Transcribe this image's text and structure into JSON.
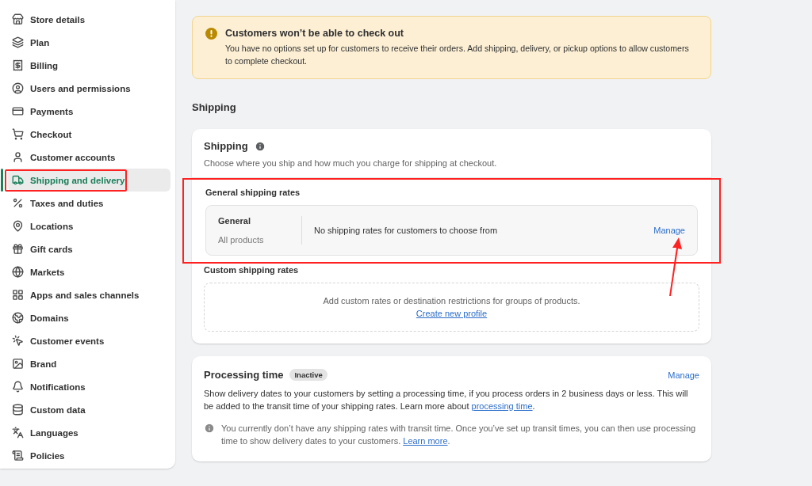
{
  "sidebar": {
    "items": [
      {
        "label": "Store details",
        "selected": false,
        "highlighted": false
      },
      {
        "label": "Plan",
        "selected": false,
        "highlighted": false
      },
      {
        "label": "Billing",
        "selected": false,
        "highlighted": false
      },
      {
        "label": "Users and permissions",
        "selected": false,
        "highlighted": false
      },
      {
        "label": "Payments",
        "selected": false,
        "highlighted": false
      },
      {
        "label": "Checkout",
        "selected": false,
        "highlighted": false
      },
      {
        "label": "Customer accounts",
        "selected": false,
        "highlighted": false
      },
      {
        "label": "Shipping and delivery",
        "selected": true,
        "highlighted": true
      },
      {
        "label": "Taxes and duties",
        "selected": false,
        "highlighted": false
      },
      {
        "label": "Locations",
        "selected": false,
        "highlighted": false
      },
      {
        "label": "Gift cards",
        "selected": false,
        "highlighted": false
      },
      {
        "label": "Markets",
        "selected": false,
        "highlighted": false
      },
      {
        "label": "Apps and sales channels",
        "selected": false,
        "highlighted": false
      },
      {
        "label": "Domains",
        "selected": false,
        "highlighted": false
      },
      {
        "label": "Customer events",
        "selected": false,
        "highlighted": false
      },
      {
        "label": "Brand",
        "selected": false,
        "highlighted": false
      },
      {
        "label": "Notifications",
        "selected": false,
        "highlighted": false
      },
      {
        "label": "Custom data",
        "selected": false,
        "highlighted": false
      },
      {
        "label": "Languages",
        "selected": false,
        "highlighted": false
      },
      {
        "label": "Policies",
        "selected": false,
        "highlighted": false
      }
    ]
  },
  "banner": {
    "title": "Customers won’t be able to check out",
    "text": "You have no options set up for customers to receive their orders. Add shipping, delivery, or pickup options to allow customers to complete checkout."
  },
  "section_title": "Shipping",
  "shipping_card": {
    "title": "Shipping",
    "subtitle": "Choose where you ship and how much you charge for shipping at checkout.",
    "general_rates": {
      "heading": "General shipping rates",
      "highlighted": true,
      "profile_name": "General",
      "profile_scope": "All products",
      "status": "No shipping rates for customers to choose from",
      "action": "Manage",
      "arrow": true
    },
    "custom_rates": {
      "heading": "Custom shipping rates",
      "text": "Add custom rates or destination restrictions for groups of products.",
      "link": "Create new profile"
    }
  },
  "processing_card": {
    "title": "Processing time",
    "badge": "Inactive",
    "action": "Manage",
    "text_before": "Show delivery dates to your customers by setting a processing time, if you process orders in 2 business days or less. This will be added to the transit time of your shipping rates. Learn more about ",
    "link": "processing time",
    "text_after": ".",
    "note_before": "You currently don’t have any shipping rates with transit time. Once you’ve set up transit times, you can then use processing time to show delivery dates to your customers. ",
    "note_link": "Learn more",
    "note_after": "."
  }
}
